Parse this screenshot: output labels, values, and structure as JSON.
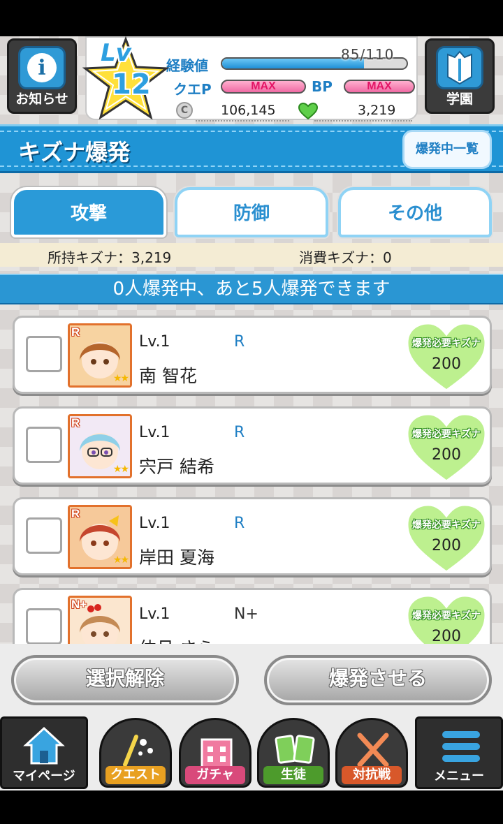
{
  "header": {
    "notice_label": "お知らせ",
    "academy_label": "学園",
    "level_prefix": "Lv",
    "level": "12",
    "exp_label": "経験値",
    "exp_text": "85/110",
    "exp_fraction": 0.77,
    "quest_label": "クエP",
    "quest_value": "MAX",
    "bp_label": "BP",
    "bp_value": "MAX",
    "coin_icon_text": "C",
    "coins": "106,145",
    "kizuna_points": "3,219"
  },
  "title": {
    "text": "キズナ爆発",
    "list_button": "爆発中一覧"
  },
  "tabs": [
    {
      "label": "攻撃",
      "active": true
    },
    {
      "label": "防御",
      "active": false
    },
    {
      "label": "その他",
      "active": false
    }
  ],
  "kizuna_bar": {
    "owned": "所持キズナ：3,219",
    "cost": "消費キズナ：0"
  },
  "banner": "0人爆発中、あと5人爆発できます",
  "cards": [
    {
      "level": "Lv.1",
      "rarity": "R",
      "name": "南 智花",
      "badge": "R",
      "stars": "★★",
      "required_label": "爆発必要キズナ",
      "required": "200",
      "hair": "#b5652c",
      "bg": "#f7d3a1"
    },
    {
      "level": "Lv.1",
      "rarity": "R",
      "name": "宍戸 結希",
      "badge": "R",
      "stars": "★★",
      "required_label": "爆発必要キズナ",
      "required": "200",
      "hair": "#8fd0e8",
      "bg": "#f2e9f5"
    },
    {
      "level": "Lv.1",
      "rarity": "R",
      "name": "岸田 夏海",
      "badge": "R",
      "stars": "★★",
      "required_label": "爆発必要キズナ",
      "required": "200",
      "hair": "#c5462e",
      "bg": "#f6c99a"
    },
    {
      "level": "Lv.1",
      "rarity": "N+",
      "name": "仲月 さら",
      "badge": "N+",
      "stars": "★★",
      "required_label": "爆発必要キズナ",
      "required": "200",
      "hair": "#c48a55",
      "bg": "#fbe6cf"
    }
  ],
  "actions": {
    "deselect": "選択解除",
    "explode": "爆発させる"
  },
  "nav": {
    "mypage": "マイページ",
    "quest": "クエスト",
    "gacha": "ガチャ",
    "students": "生徒",
    "pvp": "対抗戦",
    "menu": "メニュー"
  },
  "colors": {
    "accent": "#2a96d3",
    "heart": "#b8ec8a",
    "max_pink": "#f06aa3"
  }
}
